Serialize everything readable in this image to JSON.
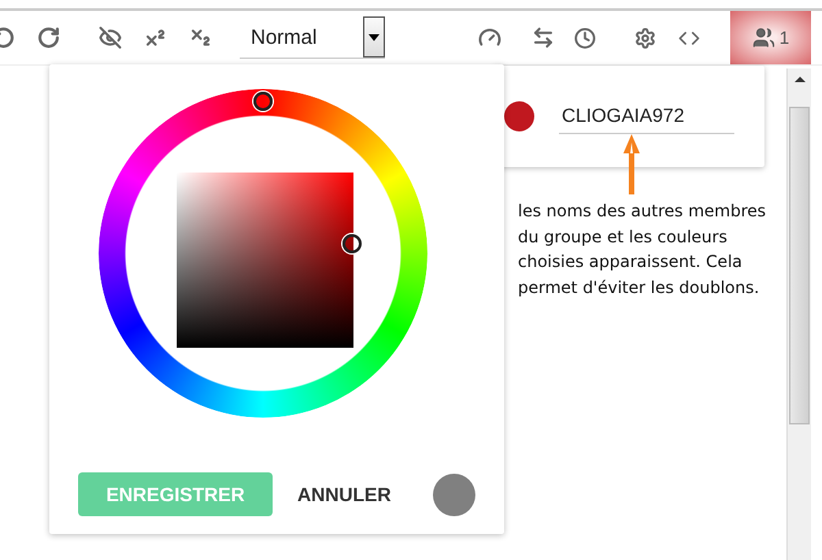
{
  "toolbar": {
    "format_select": {
      "value": "Normal"
    },
    "users_button": {
      "count": "1",
      "selected": true
    }
  },
  "users_popup": {
    "members": [
      {
        "name": "CLIOGAIA972",
        "color": "#c0181f"
      }
    ]
  },
  "note": "les noms des autres membres du groupe et les couleurs choisies apparaissent. Cela permet d'éviter les doublons.",
  "color_picker": {
    "save_label": "ENREGISTRER",
    "cancel_label": "ANNULER"
  }
}
